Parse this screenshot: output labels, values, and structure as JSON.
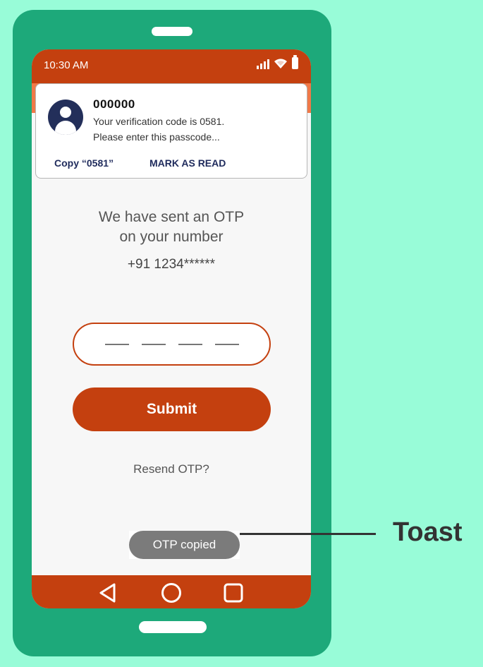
{
  "status_bar": {
    "time": "10:30 AM"
  },
  "notification": {
    "sender": "000000",
    "line1": "Your verification code is 0581.",
    "line2": "Please enter this passcode...",
    "actions": {
      "copy": "Copy “0581”",
      "mark_read": "MARK AS READ"
    }
  },
  "otp_screen": {
    "heading_line1": "We have sent an OTP",
    "heading_line2": "on your number",
    "phone_number": "+91 1234******",
    "submit_label": "Submit",
    "resend_label": "Resend OTP?"
  },
  "toast": {
    "message": "OTP copied"
  },
  "annotation": {
    "label": "Toast"
  },
  "colors": {
    "background": "#98fcd8",
    "phone_body": "#1da97a",
    "accent": "#c4400f",
    "notification_action": "#1f2b5c",
    "toast_bg": "#7b7b7b"
  },
  "icons": [
    "signal-icon",
    "wifi-icon",
    "battery-icon",
    "avatar-icon",
    "back-icon",
    "home-icon",
    "recents-icon"
  ]
}
